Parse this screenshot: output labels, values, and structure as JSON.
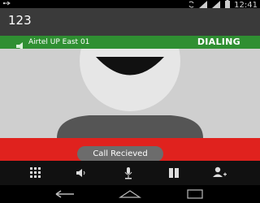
{
  "status_bar": {
    "time": "12:41",
    "icons": [
      "usb-icon",
      "sync-icon",
      "signal-icon",
      "signal-icon",
      "battery-icon"
    ]
  },
  "call": {
    "number": "123",
    "provider": "Airtel UP East 01",
    "state": "DIALING"
  },
  "toast": {
    "message": "Call Recieved"
  },
  "controls": {
    "buttons": [
      "dialpad-icon",
      "speaker-icon",
      "mute-icon",
      "hold-icon",
      "add-call-icon"
    ]
  },
  "nav": {
    "buttons": [
      "back-icon",
      "home-icon",
      "recents-icon"
    ]
  },
  "colors": {
    "provider_bar": "#2f8f32",
    "end_call_band": "#e0221e",
    "caller_bg": "#3a3a3a",
    "photo_bg": "#cfcfcf"
  }
}
